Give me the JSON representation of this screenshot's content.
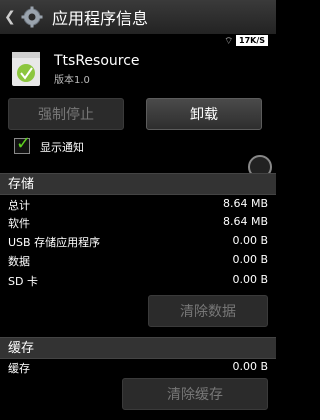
{
  "header": {
    "title": "应用程序信息"
  },
  "status": {
    "speed": "17K/S"
  },
  "app": {
    "name": "TtsResource",
    "version": "版本1.0"
  },
  "buttons": {
    "force_stop": "强制停止",
    "uninstall": "卸载"
  },
  "notify": {
    "label": "显示通知",
    "checked": true
  },
  "storage": {
    "title": "存储",
    "rows": [
      {
        "label": "总计",
        "value": "8.64 MB"
      },
      {
        "label": "软件",
        "value": "8.64 MB"
      },
      {
        "label": "USB 存储应用程序",
        "value": "0.00 B"
      },
      {
        "label": "数据",
        "value": "0.00 B"
      },
      {
        "label": "SD 卡",
        "value": "0.00 B"
      }
    ],
    "clear_data": "清除数据"
  },
  "cache": {
    "title": "缓存",
    "rows": [
      {
        "label": "缓存",
        "value": "0.00 B"
      }
    ],
    "clear_cache": "清除缓存"
  }
}
